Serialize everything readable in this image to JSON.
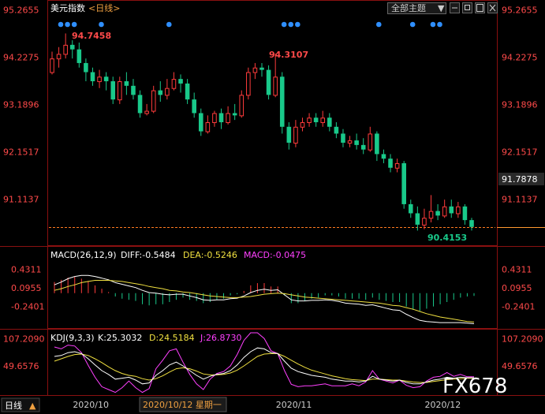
{
  "header": {
    "title": "美元指数",
    "period_link": "<日线>",
    "theme_select": "全部主题",
    "theme_arrow": "▼"
  },
  "colors": {
    "up": "#ff3b3b",
    "down": "#19c98a",
    "axis_text": "#ff4a4a",
    "macd_label": "#ffffff",
    "diff": "#ffffff",
    "dea": "#f0e040",
    "macd_bar": "#ff40ff",
    "kdj_k": "#ffffff",
    "kdj_d": "#f0e040",
    "kdj_j": "#ff40ff",
    "event_dot": "#2f8fff",
    "last_price_line": "#ff7a20",
    "current_label_bg": "#333333"
  },
  "main_chart": {
    "price_axis": [
      "95.2655",
      "94.2275",
      "93.1896",
      "92.1517",
      "91.1137"
    ],
    "y_range": [
      90.15,
      95.45
    ],
    "high_label": "94.7458",
    "mid_high_label": "94.3107",
    "low_label": "90.4153",
    "current_price": "91.7878"
  },
  "chart_data": {
    "type": "candlestick",
    "x_labels": [
      "2020/10",
      "2020/11",
      "2020/12"
    ],
    "candles": [
      [
        93.9,
        94.2,
        94.35,
        93.85
      ],
      [
        94.2,
        94.3,
        94.45,
        94.0
      ],
      [
        94.3,
        94.5,
        94.75,
        94.2
      ],
      [
        94.5,
        94.4,
        94.6,
        94.2
      ],
      [
        94.4,
        94.1,
        94.55,
        94.0
      ],
      [
        94.1,
        93.9,
        94.2,
        93.7
      ],
      [
        93.9,
        93.7,
        94.0,
        93.6
      ],
      [
        93.7,
        93.8,
        93.95,
        93.55
      ],
      [
        93.8,
        93.7,
        93.9,
        93.5
      ],
      [
        93.7,
        93.3,
        93.8,
        93.2
      ],
      [
        93.3,
        93.7,
        93.8,
        93.2
      ],
      [
        93.7,
        93.6,
        93.9,
        93.4
      ],
      [
        93.6,
        93.4,
        93.75,
        93.3
      ],
      [
        93.4,
        93.0,
        93.5,
        92.9
      ],
      [
        93.0,
        93.05,
        93.2,
        92.95
      ],
      [
        93.05,
        93.5,
        93.6,
        93.0
      ],
      [
        93.5,
        93.4,
        93.7,
        93.25
      ],
      [
        93.4,
        93.55,
        93.75,
        93.3
      ],
      [
        93.55,
        93.75,
        93.9,
        93.5
      ],
      [
        93.75,
        93.65,
        93.85,
        93.45
      ],
      [
        93.65,
        93.3,
        93.75,
        93.2
      ],
      [
        93.3,
        93.0,
        93.45,
        92.9
      ],
      [
        93.0,
        92.6,
        93.1,
        92.5
      ],
      [
        92.6,
        92.8,
        92.95,
        92.55
      ],
      [
        92.8,
        93.0,
        93.05,
        92.7
      ],
      [
        93.0,
        92.8,
        93.1,
        92.65
      ],
      [
        92.8,
        93.0,
        93.15,
        92.75
      ],
      [
        93.0,
        92.95,
        93.2,
        92.85
      ],
      [
        92.95,
        93.4,
        93.5,
        92.9
      ],
      [
        93.4,
        93.9,
        94.0,
        93.3
      ],
      [
        93.9,
        94.0,
        94.1,
        93.75
      ],
      [
        94.0,
        93.95,
        94.1,
        93.8
      ],
      [
        93.95,
        93.4,
        94.05,
        93.3
      ],
      [
        93.4,
        93.8,
        94.31,
        93.35
      ],
      [
        93.8,
        92.7,
        93.9,
        92.55
      ],
      [
        92.7,
        92.35,
        92.8,
        92.2
      ],
      [
        92.35,
        92.7,
        92.85,
        92.25
      ],
      [
        92.7,
        92.8,
        92.9,
        92.6
      ],
      [
        92.8,
        92.9,
        93.0,
        92.7
      ],
      [
        92.9,
        92.8,
        93.0,
        92.7
      ],
      [
        92.8,
        92.9,
        93.05,
        92.7
      ],
      [
        92.9,
        92.7,
        93.0,
        92.6
      ],
      [
        92.7,
        92.55,
        92.8,
        92.45
      ],
      [
        92.55,
        92.35,
        92.65,
        92.25
      ],
      [
        92.35,
        92.4,
        92.5,
        92.25
      ],
      [
        92.4,
        92.3,
        92.55,
        92.2
      ],
      [
        92.3,
        92.2,
        92.45,
        92.1
      ],
      [
        92.2,
        92.55,
        92.7,
        92.15
      ],
      [
        92.55,
        92.1,
        92.6,
        91.95
      ],
      [
        92.1,
        92.0,
        92.2,
        91.9
      ],
      [
        92.0,
        91.8,
        92.1,
        91.7
      ],
      [
        91.8,
        91.9,
        92.0,
        91.7
      ],
      [
        91.9,
        91.0,
        91.95,
        90.9
      ],
      [
        91.0,
        90.8,
        91.1,
        90.7
      ],
      [
        90.8,
        90.55,
        90.95,
        90.42
      ],
      [
        90.55,
        90.7,
        90.9,
        90.45
      ],
      [
        90.7,
        90.85,
        91.2,
        90.6
      ],
      [
        90.85,
        90.75,
        91.0,
        90.65
      ],
      [
        90.75,
        90.95,
        91.1,
        90.7
      ],
      [
        90.95,
        90.8,
        91.1,
        90.7
      ],
      [
        90.8,
        90.95,
        91.05,
        90.7
      ],
      [
        90.95,
        90.65,
        91.0,
        90.55
      ],
      [
        90.65,
        90.5,
        90.7,
        90.42
      ]
    ],
    "event_dot_groups": [
      [
        0,
        1,
        2
      ],
      [
        6
      ],
      [
        16
      ],
      [
        33,
        34,
        35
      ],
      [
        47
      ],
      [
        52
      ],
      [
        55,
        56
      ]
    ]
  },
  "macd": {
    "label": "MACD(26,12,9)",
    "diff_text": "DIFF:-0.5484",
    "dea_text": "DEA:-0.5246",
    "macd_text": "MACD:-0.0475",
    "axis": [
      "0.4311",
      "0.0955",
      "-0.2401"
    ],
    "range": [
      -0.6,
      0.55
    ],
    "diff": [
      0.15,
      0.2,
      0.26,
      0.3,
      0.32,
      0.32,
      0.3,
      0.27,
      0.24,
      0.19,
      0.16,
      0.13,
      0.1,
      0.05,
      0.01,
      0.0,
      -0.02,
      -0.03,
      -0.02,
      -0.02,
      -0.05,
      -0.08,
      -0.12,
      -0.13,
      -0.12,
      -0.12,
      -0.1,
      -0.09,
      -0.05,
      0.01,
      0.05,
      0.07,
      0.05,
      0.06,
      -0.03,
      -0.12,
      -0.14,
      -0.14,
      -0.13,
      -0.13,
      -0.12,
      -0.13,
      -0.15,
      -0.18,
      -0.19,
      -0.2,
      -0.22,
      -0.21,
      -0.24,
      -0.27,
      -0.3,
      -0.31,
      -0.38,
      -0.44,
      -0.49,
      -0.51,
      -0.52,
      -0.53,
      -0.53,
      -0.53,
      -0.53,
      -0.54,
      -0.55
    ],
    "dea": [
      0.05,
      0.08,
      0.12,
      0.15,
      0.19,
      0.21,
      0.23,
      0.23,
      0.23,
      0.22,
      0.21,
      0.19,
      0.17,
      0.15,
      0.12,
      0.1,
      0.08,
      0.05,
      0.04,
      0.02,
      0.01,
      -0.01,
      -0.03,
      -0.05,
      -0.06,
      -0.07,
      -0.08,
      -0.08,
      -0.07,
      -0.06,
      -0.04,
      -0.02,
      -0.01,
      0.0,
      -0.01,
      -0.03,
      -0.05,
      -0.07,
      -0.08,
      -0.09,
      -0.1,
      -0.11,
      -0.12,
      -0.13,
      -0.14,
      -0.15,
      -0.16,
      -0.17,
      -0.18,
      -0.2,
      -0.22,
      -0.23,
      -0.26,
      -0.29,
      -0.33,
      -0.37,
      -0.4,
      -0.43,
      -0.45,
      -0.47,
      -0.49,
      -0.51,
      -0.52
    ],
    "bars": [
      0.2,
      0.24,
      0.28,
      0.3,
      0.26,
      0.22,
      0.14,
      0.08,
      0.02,
      -0.06,
      -0.1,
      -0.12,
      -0.14,
      -0.2,
      -0.22,
      -0.2,
      -0.2,
      -0.16,
      -0.12,
      -0.08,
      -0.12,
      -0.14,
      -0.18,
      -0.16,
      -0.12,
      -0.1,
      -0.04,
      -0.02,
      0.04,
      0.14,
      0.18,
      0.18,
      0.12,
      0.12,
      -0.04,
      -0.18,
      -0.18,
      -0.14,
      -0.1,
      -0.08,
      -0.04,
      -0.04,
      -0.06,
      -0.1,
      -0.1,
      -0.1,
      -0.12,
      -0.08,
      -0.12,
      -0.14,
      -0.16,
      -0.16,
      -0.24,
      -0.3,
      -0.32,
      -0.28,
      -0.24,
      -0.2,
      -0.16,
      -0.12,
      -0.08,
      -0.06,
      -0.05
    ]
  },
  "kdj": {
    "label": "KDJ(9,3,3)",
    "k_text": "K:25.3032",
    "d_text": "D:24.5184",
    "j_text": "J:26.8730",
    "axis": [
      "107.2090",
      "49.6576"
    ],
    "range": [
      -10,
      120
    ],
    "k": [
      70,
      72,
      78,
      80,
      76,
      65,
      52,
      40,
      32,
      22,
      24,
      26,
      20,
      12,
      14,
      30,
      40,
      52,
      58,
      50,
      40,
      30,
      22,
      28,
      32,
      34,
      40,
      52,
      68,
      80,
      88,
      86,
      78,
      76,
      60,
      45,
      38,
      34,
      30,
      28,
      26,
      22,
      20,
      18,
      18,
      16,
      18,
      28,
      22,
      20,
      18,
      20,
      15,
      12,
      12,
      16,
      20,
      22,
      26,
      24,
      26,
      25,
      25
    ],
    "d": [
      60,
      65,
      70,
      74,
      75,
      72,
      65,
      57,
      48,
      40,
      34,
      30,
      28,
      23,
      20,
      23,
      29,
      37,
      44,
      46,
      44,
      39,
      33,
      31,
      31,
      32,
      35,
      41,
      50,
      60,
      70,
      75,
      76,
      76,
      70,
      62,
      54,
      47,
      41,
      37,
      33,
      29,
      26,
      23,
      21,
      20,
      19,
      22,
      22,
      21,
      20,
      20,
      18,
      16,
      15,
      15,
      17,
      19,
      21,
      22,
      23,
      24,
      24
    ],
    "j": [
      90,
      86,
      94,
      92,
      78,
      51,
      26,
      6,
      0,
      -6,
      4,
      18,
      4,
      -6,
      2,
      44,
      62,
      82,
      86,
      58,
      32,
      12,
      0,
      22,
      34,
      38,
      50,
      74,
      104,
      120,
      120,
      108,
      82,
      76,
      40,
      11,
      6,
      8,
      8,
      10,
      12,
      8,
      8,
      8,
      12,
      8,
      16,
      40,
      22,
      18,
      14,
      20,
      9,
      4,
      6,
      18,
      26,
      28,
      36,
      28,
      32,
      27,
      27
    ]
  },
  "footer": {
    "period": "日线",
    "period_arrow": "▲",
    "date_cursor": "2020/10/12 星期一",
    "watermark": "FX678"
  }
}
